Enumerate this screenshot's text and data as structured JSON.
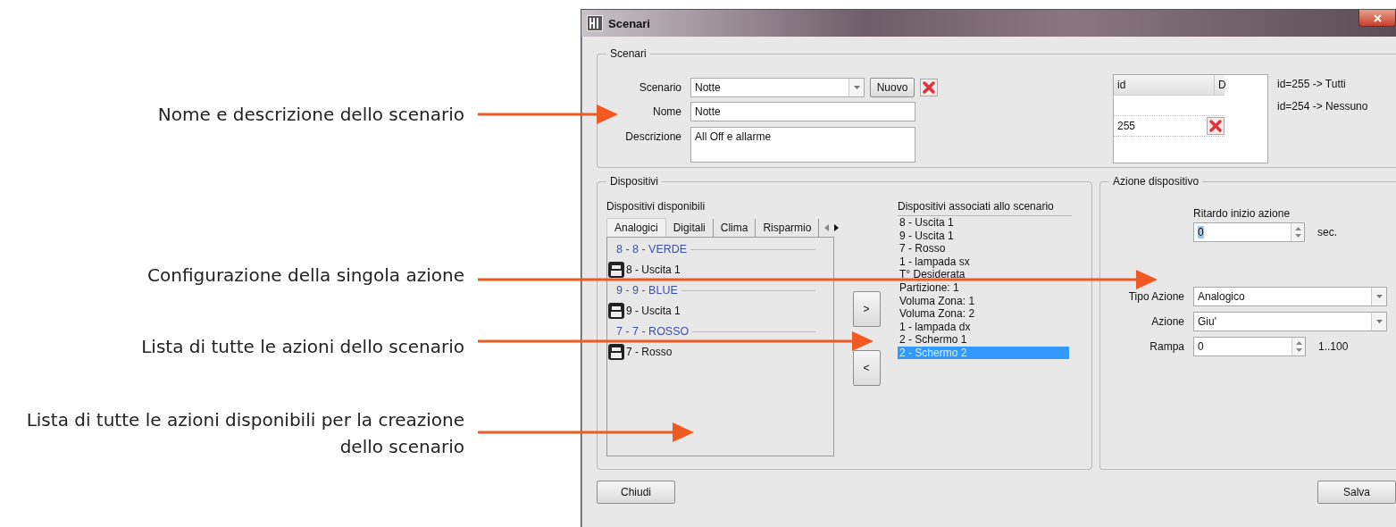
{
  "annotations": [
    {
      "text": "Nome e descrizione dello scenario"
    },
    {
      "text": "Configurazione della singola azione"
    },
    {
      "text": "Lista di tutte le azioni dello scenario"
    },
    {
      "text": "Lista di tutte le azioni disponibili per la creazione dello scenario"
    }
  ],
  "window": {
    "title": "Scenari"
  },
  "scenari": {
    "legend": "Scenari",
    "scenario": {
      "label": "Scenario",
      "value": "Notte"
    },
    "new_button": "Nuovo",
    "nome": {
      "label": "Nome",
      "value": "Notte"
    },
    "descrizione": {
      "label": "Descrizione",
      "value": "All Off e allarme"
    },
    "table": {
      "columns": [
        "id",
        "D"
      ],
      "rows": [
        {
          "id": "255"
        }
      ]
    },
    "notes": [
      "id=255 -> Tutti",
      "id=254 -> Nessuno"
    ]
  },
  "dispositivi": {
    "legend": "Dispositivi",
    "available_label": "Dispositivi disponibili",
    "tabs": [
      {
        "label": "Analogici",
        "selected": true
      },
      {
        "label": "Digitali",
        "selected": false
      },
      {
        "label": "Clima",
        "selected": false
      },
      {
        "label": "Risparmio",
        "selected": false
      }
    ],
    "available": [
      {
        "kind": "group",
        "text": "8 - 8 - VERDE"
      },
      {
        "kind": "device",
        "text": "8 - Uscita 1"
      },
      {
        "kind": "group",
        "text": "9 - 9 - BLUE"
      },
      {
        "kind": "device",
        "text": "9 - Uscita 1"
      },
      {
        "kind": "group",
        "text": "7 - 7 - ROSSO"
      },
      {
        "kind": "device",
        "text": "7 - Rosso"
      }
    ],
    "add_button": ">",
    "remove_button": "<",
    "associated_label": "Dispositivi associati allo scenario",
    "associated": [
      {
        "text": "8 - Uscita 1",
        "selected": false
      },
      {
        "text": "9 - Uscita 1",
        "selected": false
      },
      {
        "text": "7 - Rosso",
        "selected": false
      },
      {
        "text": "1 - lampada sx",
        "selected": false
      },
      {
        "text": "T° Desiderata",
        "selected": false
      },
      {
        "text": "Partizione: 1",
        "selected": false
      },
      {
        "text": "Voluma Zona: 1",
        "selected": false
      },
      {
        "text": "Voluma Zona: 2",
        "selected": false
      },
      {
        "text": "1 - lampada dx",
        "selected": false
      },
      {
        "text": "2 - Schermo 1",
        "selected": false
      },
      {
        "text": "2 - Schermo 2",
        "selected": true
      }
    ]
  },
  "azione": {
    "legend": "Azione dispositivo",
    "ritardo": {
      "label": "Ritardo inizio azione",
      "value": "0",
      "focused": true,
      "unit": "sec."
    },
    "tipo": {
      "label": "Tipo Azione",
      "value": "Analogico"
    },
    "azione": {
      "label": "Azione",
      "value": "Giu'"
    },
    "rampa": {
      "label": "Rampa",
      "value": "0",
      "range": "1..100"
    }
  },
  "buttons": {
    "close": "Chiudi",
    "save": "Salva"
  }
}
